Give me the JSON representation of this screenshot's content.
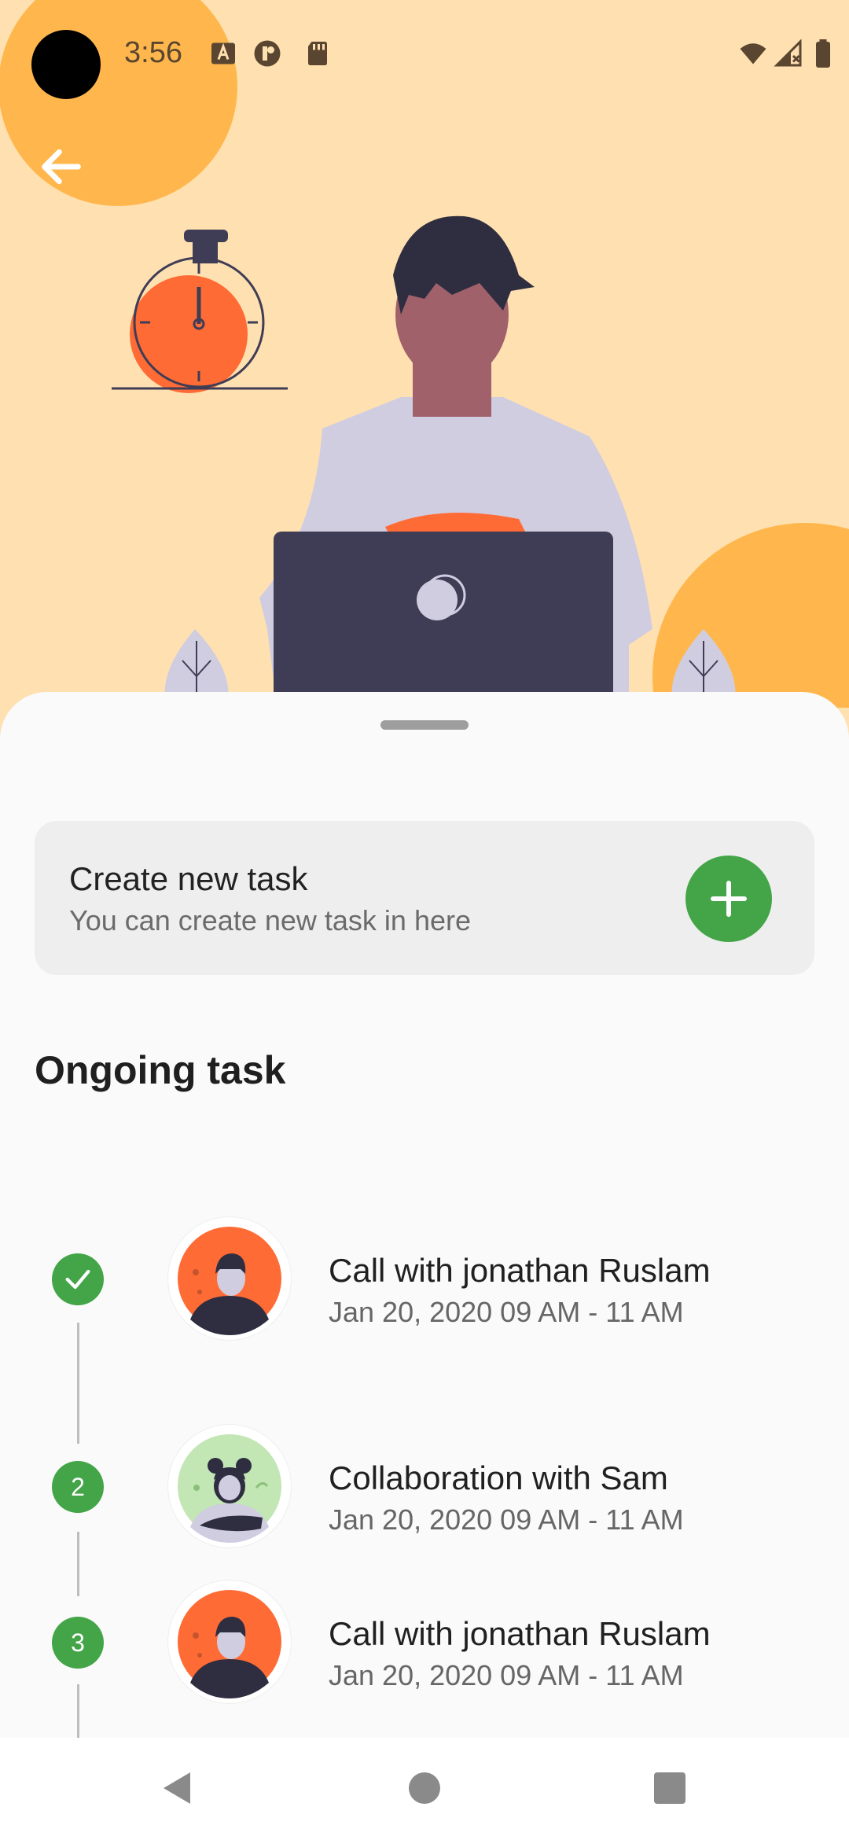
{
  "status_bar": {
    "time": "3:56"
  },
  "create_task": {
    "title": "Create new task",
    "subtitle": "You can create new task in here"
  },
  "section": {
    "title": "Ongoing task"
  },
  "tasks": [
    {
      "index": "",
      "status": "done",
      "title": "Call with jonathan Ruslam",
      "date": "Jan 20, 2020  09 AM - 11 AM",
      "avatar": "man-orange-avatar"
    },
    {
      "index": "2",
      "status": "pending",
      "title": "Collaboration with Sam",
      "date": "Jan 20, 2020  09 AM - 11 AM",
      "avatar": "woman-green-avatar"
    },
    {
      "index": "3",
      "status": "pending",
      "title": "Call with jonathan Ruslam",
      "date": "Jan 20, 2020  09 AM - 11 AM",
      "avatar": "man-orange-avatar"
    }
  ],
  "colors": {
    "accent_green": "#43A547",
    "hero_bg": "#FFE0B0",
    "hero_circle": "#FFB74D",
    "stopwatch": "#FF6B35"
  }
}
